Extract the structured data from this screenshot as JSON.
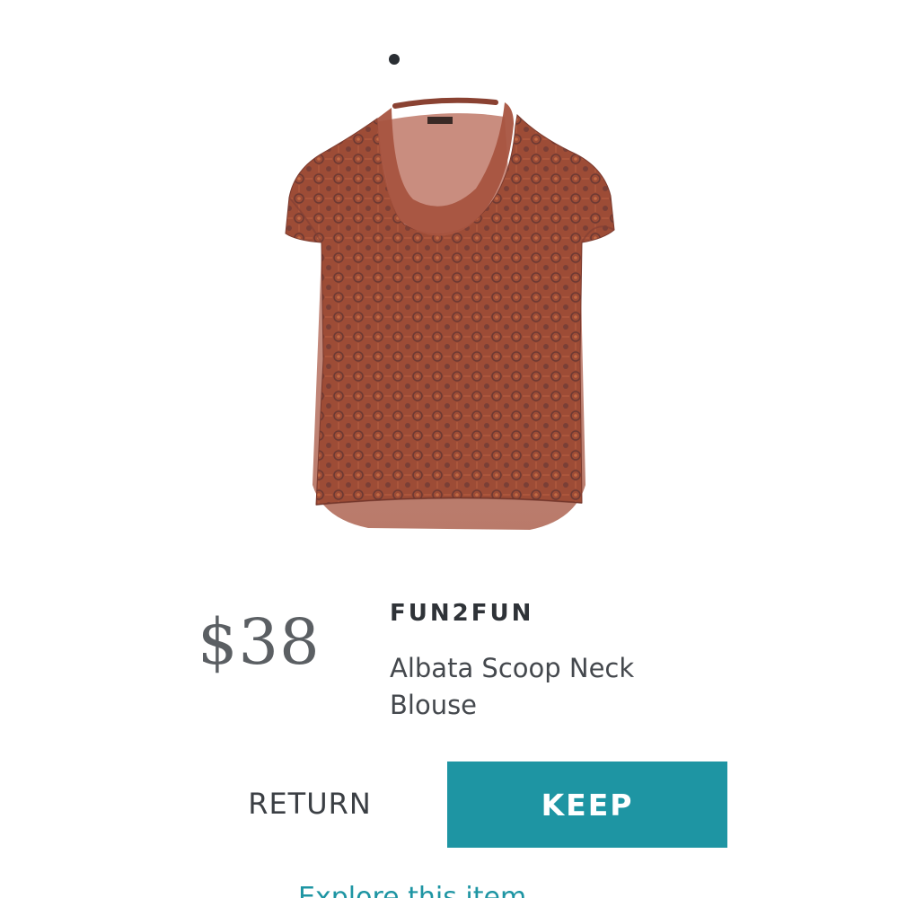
{
  "carousel": {
    "active_index": 1,
    "count": 1
  },
  "product": {
    "image_icon": "blouse-product-photo",
    "price": "$38",
    "brand": "FUN2FUN",
    "name": "Albata Scoop Neck Blouse",
    "name_line1": "Albata Scoop Neck",
    "name_line2": "Blouse",
    "color": "#9a4a35"
  },
  "actions": {
    "return_label": "RETURN",
    "keep_label": "KEEP",
    "explore_label": "Explore this item"
  },
  "colors": {
    "accent": "#1e95a3",
    "price_text": "#5b5f63",
    "brand_text": "#2f3338"
  }
}
